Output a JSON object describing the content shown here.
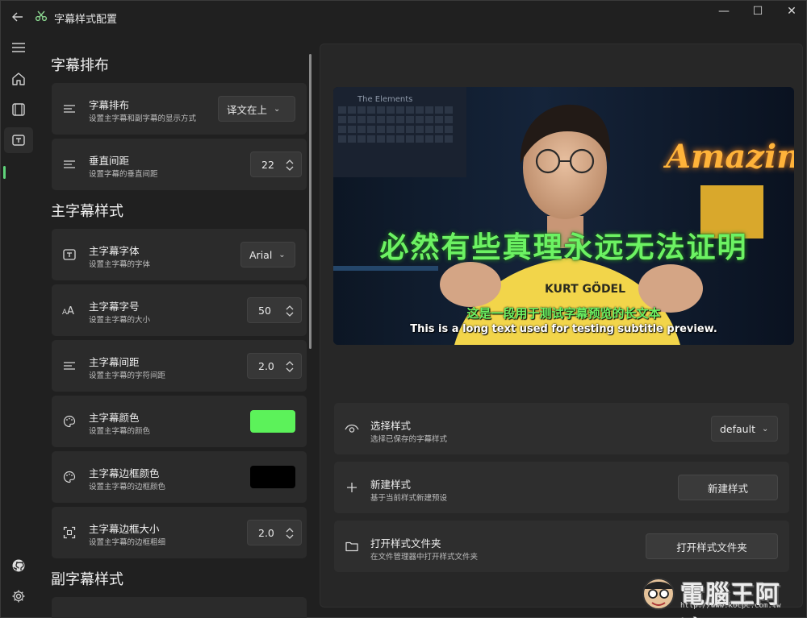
{
  "window": {
    "title": "字幕样式配置",
    "controls": {
      "minimize": "—",
      "maximize": "☐",
      "close": "✕"
    }
  },
  "rail": {
    "items": [
      {
        "name": "menu-icon"
      },
      {
        "name": "home-icon"
      },
      {
        "name": "film-icon"
      },
      {
        "name": "subtitle-icon",
        "active": true
      }
    ],
    "bottom": [
      {
        "name": "github-icon"
      },
      {
        "name": "gear-icon"
      }
    ]
  },
  "left": {
    "sections": {
      "layout": "字幕排布",
      "main_style": "主字幕样式",
      "sub_style": "副字幕样式"
    },
    "layout_card": {
      "title": "字幕排布",
      "subtitle": "设置主字幕和副字幕的显示方式",
      "value": "译文在上"
    },
    "spacing_card": {
      "title": "垂直间距",
      "subtitle": "设置字幕的垂直间距",
      "value": "22"
    },
    "font_card": {
      "title": "主字幕字体",
      "subtitle": "设置主字幕的字体",
      "value": "Arial"
    },
    "size_card": {
      "title": "主字幕字号",
      "subtitle": "设置主字幕的大小",
      "value": "50"
    },
    "letter_card": {
      "title": "主字幕间距",
      "subtitle": "设置主字幕的字符间距",
      "value": "2.0"
    },
    "color_card": {
      "title": "主字幕颜色",
      "subtitle": "设置主字幕的颜色",
      "color": "#5cf25a"
    },
    "border_color_card": {
      "title": "主字幕边框颜色",
      "subtitle": "设置主字幕的边框颜色",
      "color": "#000000"
    },
    "border_size_card": {
      "title": "主字幕边框大小",
      "subtitle": "设置主字幕的边框粗细",
      "value": "2.0"
    }
  },
  "preview": {
    "main_text": "必然有些真理永远无法证明",
    "sub_zh": "这是一段用于测试字幕预览的长文本",
    "sub_en": "This is a long text used for testing subtitle preview.",
    "sign": "Amazin",
    "board": "The Elements",
    "shirt": "KURT GÖDEL"
  },
  "right": {
    "select_card": {
      "title": "选择样式",
      "subtitle": "选择已保存的字幕样式",
      "value": "default"
    },
    "new_card": {
      "title": "新建样式",
      "subtitle": "基于当前样式新建预设",
      "button": "新建样式"
    },
    "open_card": {
      "title": "打开样式文件夹",
      "subtitle": "在文件管理器中打开样式文件夹",
      "button": "打开样式文件夹"
    }
  },
  "watermark": {
    "text": "電腦王阿達",
    "url": "http://www.kocpc.com.tw"
  }
}
